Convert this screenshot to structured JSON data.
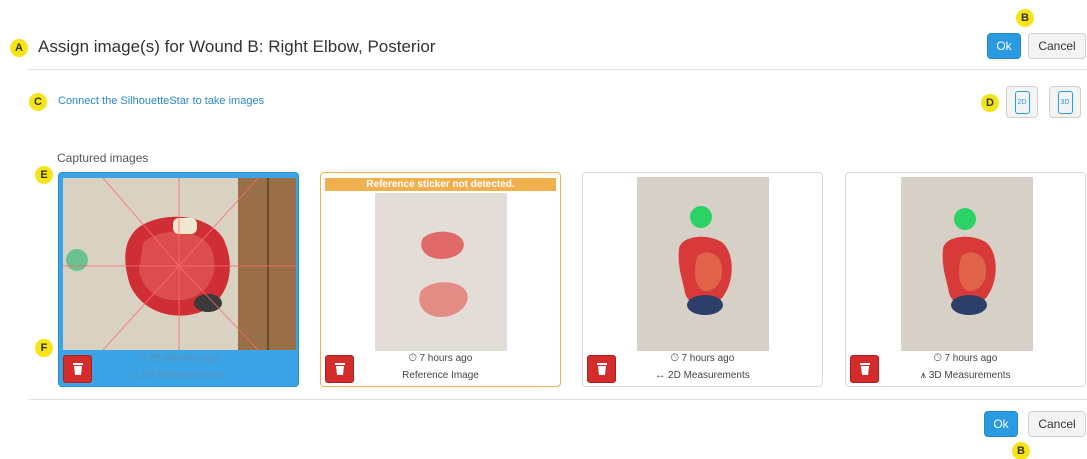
{
  "header": {
    "title": "Assign image(s) for Wound B: Right Elbow, Posterior",
    "ok_label": "Ok",
    "cancel_label": "Cancel"
  },
  "connect": {
    "link_text": "Connect the SilhouetteStar to take images"
  },
  "modes": {
    "btn_2d": "2D",
    "btn_3d": "3D"
  },
  "captured": {
    "label": "Captured images",
    "cards": [
      {
        "time": "35 minutes ago",
        "type": "3D Measurements",
        "selected": true,
        "warning": ""
      },
      {
        "time": "7 hours ago",
        "type": "Reference Image",
        "selected": false,
        "warning": "Reference sticker not detected."
      },
      {
        "time": "7 hours ago",
        "type": "2D Measurements",
        "selected": false,
        "warning": ""
      },
      {
        "time": "7 hours ago",
        "type": "3D Measurements",
        "selected": false,
        "warning": ""
      }
    ]
  },
  "footer": {
    "ok_label": "Ok",
    "cancel_label": "Cancel"
  },
  "annotations": {
    "A": "A",
    "B": "B",
    "C": "C",
    "D": "D",
    "E": "E",
    "F": "F"
  },
  "colors": {
    "primary": "#2a9be0",
    "selected_card": "#3aa4e6",
    "warning": "#efb04d",
    "delete": "#d42b2b",
    "link": "#2a87c9",
    "annotation_badge": "#f5e416"
  },
  "icons": [
    "clock-icon",
    "arrows-icon",
    "axes-icon",
    "trash-icon",
    "tablet-2d-icon",
    "tablet-3d-icon"
  ]
}
